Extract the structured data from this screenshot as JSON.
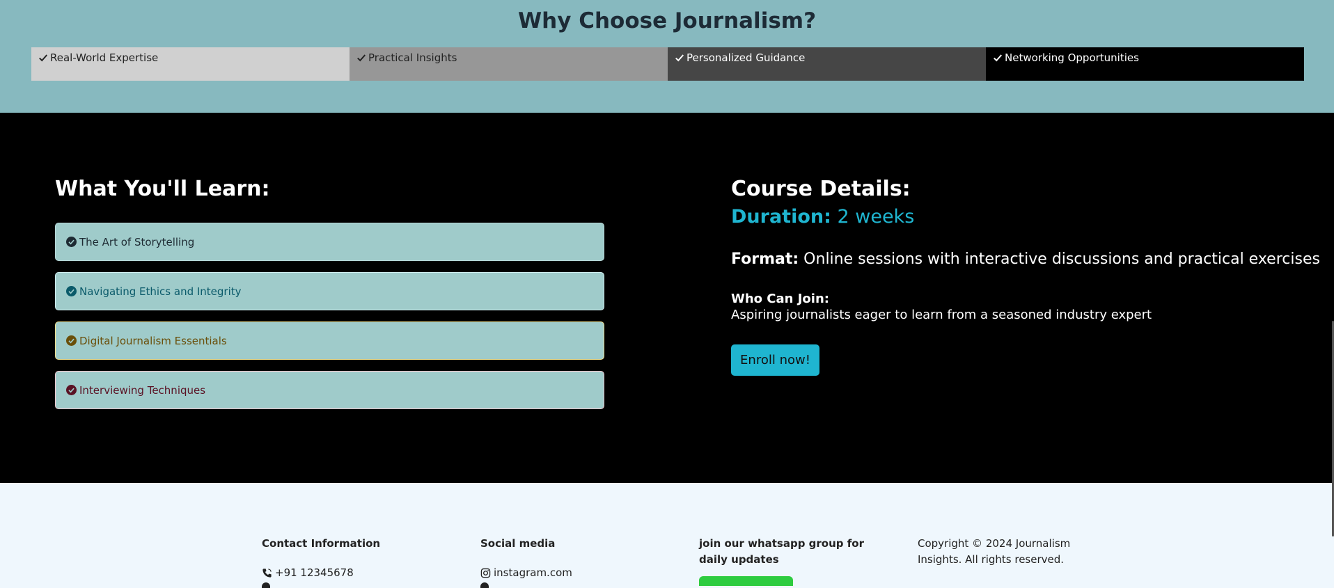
{
  "why": {
    "title": "Why Choose Journalism?",
    "features": [
      "Real-World Expertise",
      "Practical Insights",
      "Personalized Guidance",
      "Networking Opportunities"
    ]
  },
  "learn": {
    "title": "What You'll Learn:",
    "items": [
      "The Art of Storytelling",
      "Navigating Ethics and Integrity",
      "Digital Journalism Essentials",
      "Interviewing Techniques"
    ]
  },
  "course": {
    "title": "Course Details:",
    "duration_label": "Duration:",
    "duration_value": " 2 weeks",
    "format_label": "Format:",
    "format_value": " Online sessions with interactive discussions and practical exercises",
    "who_label": "Who Can Join:",
    "who_value": "Aspiring journalists eager to learn from a seasoned industry expert",
    "enroll_label": "Enroll now!"
  },
  "footer": {
    "contact_title": "Contact Information",
    "phone": "+91 12345678",
    "social_title": "Social media",
    "instagram": "instagram.com",
    "whatsapp_title": "join our whatsapp group for daily updates",
    "copyright": "Copyright © 2024 Journalism Insights. All rights reserved."
  },
  "colors": {
    "why_bg": "#87b9bf",
    "accent": "#1fb5d0",
    "learn_item_bg": "#9fcbca",
    "footer_bg": "#eff7fd",
    "whatsapp_green": "#2ecc40"
  }
}
